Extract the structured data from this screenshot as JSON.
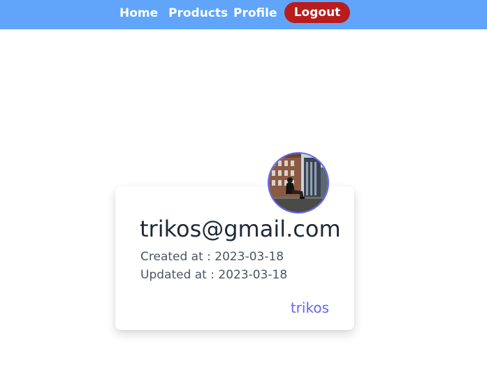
{
  "nav": {
    "links": [
      {
        "label": "Home"
      },
      {
        "label": "Products"
      },
      {
        "label": "Profile"
      }
    ],
    "logout_label": "Logout"
  },
  "profile": {
    "email": "trikos@gmail.com",
    "created": "Created at : 2023-03-18",
    "updated": "Updated at : 2023-03-18",
    "username": "trikos"
  },
  "colors": {
    "navbar": "#60a5fa",
    "logout": "#b91c1c",
    "accent": "#6366f1",
    "title": "#1f2937",
    "meta": "#4b5563"
  },
  "icons": {
    "avatar": "profile-photo"
  }
}
